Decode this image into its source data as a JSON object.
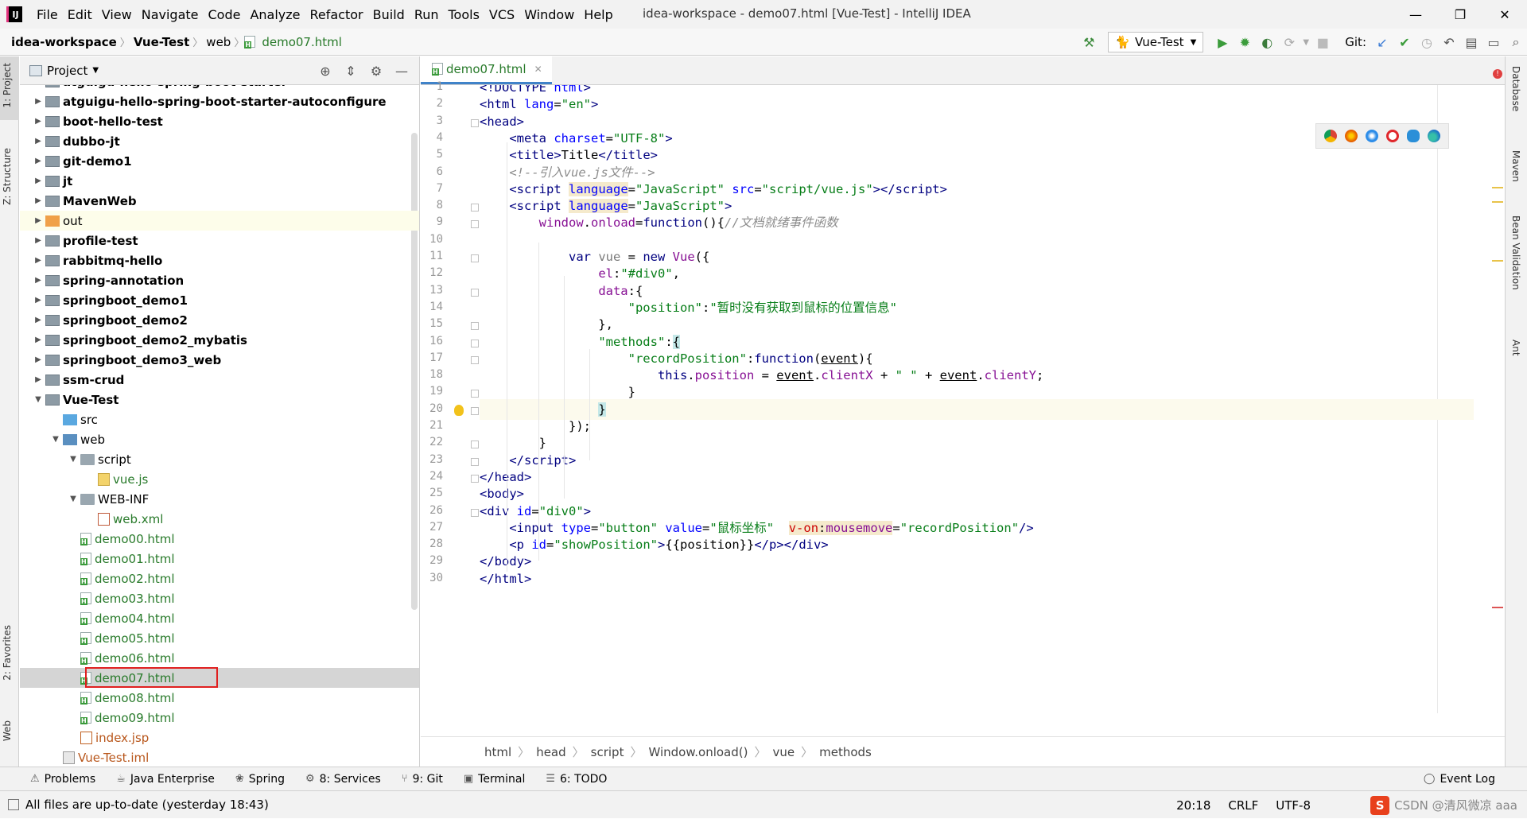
{
  "menubar": {
    "logo": "IJ",
    "items": [
      "File",
      "Edit",
      "View",
      "Navigate",
      "Code",
      "Analyze",
      "Refactor",
      "Build",
      "Run",
      "Tools",
      "VCS",
      "Window",
      "Help"
    ],
    "title": "idea-workspace - demo07.html [Vue-Test] - IntelliJ IDEA",
    "minimize": "—",
    "maximize": "❐",
    "close": "✕"
  },
  "navbar": {
    "crumbs": [
      "idea-workspace",
      "Vue-Test",
      "web",
      "demo07.html"
    ],
    "run_config": "Vue-Test",
    "git_label": "Git:"
  },
  "left_strip": {
    "project": "1: Project",
    "structure": "Z: Structure",
    "favorites": "2: Favorites",
    "web": "Web"
  },
  "right_strip": {
    "database": "Database",
    "maven": "Maven",
    "bean": "Bean Validation",
    "ant": "Ant"
  },
  "project_panel": {
    "title": "Project",
    "tree": [
      {
        "label": "atguigu-hello-spring-boot-starter",
        "depth": 1,
        "arrow": "▶",
        "icon": "mod",
        "bold": true
      },
      {
        "label": "atguigu-hello-spring-boot-starter-autoconfigure",
        "depth": 1,
        "arrow": "▶",
        "icon": "mod",
        "bold": true
      },
      {
        "label": "boot-hello-test",
        "depth": 1,
        "arrow": "▶",
        "icon": "mod",
        "bold": true
      },
      {
        "label": "dubbo-jt",
        "depth": 1,
        "arrow": "▶",
        "icon": "mod",
        "bold": true
      },
      {
        "label": "git-demo1",
        "depth": 1,
        "arrow": "▶",
        "icon": "mod",
        "bold": true
      },
      {
        "label": "jt",
        "depth": 1,
        "arrow": "▶",
        "icon": "mod",
        "bold": true
      },
      {
        "label": "MavenWeb",
        "depth": 1,
        "arrow": "▶",
        "icon": "mod",
        "bold": true
      },
      {
        "label": "out",
        "depth": 1,
        "arrow": "▶",
        "icon": "out",
        "bold": false,
        "hl": "out"
      },
      {
        "label": "profile-test",
        "depth": 1,
        "arrow": "▶",
        "icon": "mod",
        "bold": true
      },
      {
        "label": "rabbitmq-hello",
        "depth": 1,
        "arrow": "▶",
        "icon": "mod",
        "bold": true
      },
      {
        "label": "spring-annotation",
        "depth": 1,
        "arrow": "▶",
        "icon": "mod",
        "bold": true
      },
      {
        "label": "springboot_demo1",
        "depth": 1,
        "arrow": "▶",
        "icon": "mod",
        "bold": true
      },
      {
        "label": "springboot_demo2",
        "depth": 1,
        "arrow": "▶",
        "icon": "mod",
        "bold": true
      },
      {
        "label": "springboot_demo2_mybatis",
        "depth": 1,
        "arrow": "▶",
        "icon": "mod",
        "bold": true
      },
      {
        "label": "springboot_demo3_web",
        "depth": 1,
        "arrow": "▶",
        "icon": "mod",
        "bold": true
      },
      {
        "label": "ssm-crud",
        "depth": 1,
        "arrow": "▶",
        "icon": "mod",
        "bold": true
      },
      {
        "label": "Vue-Test",
        "depth": 1,
        "arrow": "▼",
        "icon": "mod",
        "bold": true
      },
      {
        "label": "src",
        "depth": 2,
        "arrow": "",
        "icon": "src",
        "bold": false
      },
      {
        "label": "web",
        "depth": 2,
        "arrow": "▼",
        "icon": "web",
        "bold": false
      },
      {
        "label": "script",
        "depth": 3,
        "arrow": "▼",
        "icon": "folder",
        "bold": false
      },
      {
        "label": "vue.js",
        "depth": 4,
        "arrow": "",
        "icon": "js",
        "bold": false,
        "color": "green"
      },
      {
        "label": "WEB-INF",
        "depth": 3,
        "arrow": "▼",
        "icon": "folder",
        "bold": false
      },
      {
        "label": "web.xml",
        "depth": 4,
        "arrow": "",
        "icon": "xml",
        "bold": false,
        "color": "green"
      },
      {
        "label": "demo00.html",
        "depth": 3,
        "arrow": "",
        "icon": "html",
        "bold": false,
        "color": "green"
      },
      {
        "label": "demo01.html",
        "depth": 3,
        "arrow": "",
        "icon": "html",
        "bold": false,
        "color": "green"
      },
      {
        "label": "demo02.html",
        "depth": 3,
        "arrow": "",
        "icon": "html",
        "bold": false,
        "color": "green"
      },
      {
        "label": "demo03.html",
        "depth": 3,
        "arrow": "",
        "icon": "html",
        "bold": false,
        "color": "green"
      },
      {
        "label": "demo04.html",
        "depth": 3,
        "arrow": "",
        "icon": "html",
        "bold": false,
        "color": "green"
      },
      {
        "label": "demo05.html",
        "depth": 3,
        "arrow": "",
        "icon": "html",
        "bold": false,
        "color": "green"
      },
      {
        "label": "demo06.html",
        "depth": 3,
        "arrow": "",
        "icon": "html",
        "bold": false,
        "color": "green"
      },
      {
        "label": "demo07.html",
        "depth": 3,
        "arrow": "",
        "icon": "html",
        "bold": false,
        "color": "green",
        "hl": "sel"
      },
      {
        "label": "demo08.html",
        "depth": 3,
        "arrow": "",
        "icon": "html",
        "bold": false,
        "color": "green"
      },
      {
        "label": "demo09.html",
        "depth": 3,
        "arrow": "",
        "icon": "html",
        "bold": false,
        "color": "green"
      },
      {
        "label": "index.jsp",
        "depth": 3,
        "arrow": "",
        "icon": "jsp",
        "bold": false,
        "color": "orange"
      },
      {
        "label": "Vue-Test.iml",
        "depth": 2,
        "arrow": "",
        "icon": "iml",
        "bold": false,
        "color": "orange"
      }
    ]
  },
  "editor": {
    "tab_label": "demo07.html",
    "current_line": 20,
    "breadcrumb": [
      "html",
      "head",
      "script",
      "Window.onload()",
      "vue",
      "methods"
    ]
  },
  "toolwindows": [
    {
      "icon": "⚠",
      "label": "Problems"
    },
    {
      "icon": "☕",
      "label": "Java Enterprise"
    },
    {
      "icon": "❀",
      "label": "Spring"
    },
    {
      "icon": "⚙",
      "label": "8: Services"
    },
    {
      "icon": "⑂",
      "label": "9: Git"
    },
    {
      "icon": "▣",
      "label": "Terminal"
    },
    {
      "icon": "☰",
      "label": "6: TODO"
    },
    {
      "icon": "◯",
      "label": "Event Log"
    }
  ],
  "statusbar": {
    "message": "All files are up-to-date (yesterday 18:43)",
    "position": "20:18",
    "line_sep": "CRLF",
    "encoding": "UTF-8",
    "watermark": "CSDN @清风微凉 aaa"
  }
}
